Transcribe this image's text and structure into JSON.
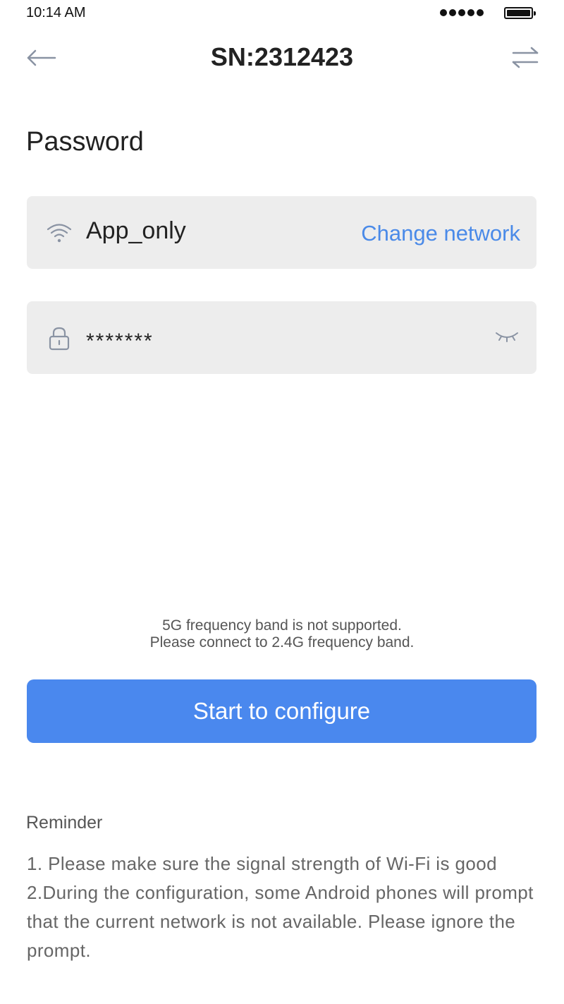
{
  "status_bar": {
    "time": "10:14 AM",
    "signal_icon": "signal-dots-icon",
    "battery_icon": "battery-icon"
  },
  "nav": {
    "title": "SN:2312423",
    "back_icon": "arrow-left-icon",
    "switch_icon": "swap-arrows-icon"
  },
  "section": {
    "title": "Password"
  },
  "network": {
    "icon": "wifi-icon",
    "name": "App_only",
    "change_label": "Change network"
  },
  "password": {
    "icon": "lock-icon",
    "value": "*******",
    "toggle_icon": "eye-closed-icon"
  },
  "notice": {
    "line1": "5G frequency band is not supported.",
    "line2": "Please connect to 2.4G frequency band."
  },
  "actions": {
    "start_label": "Start to configure"
  },
  "reminder": {
    "title": "Reminder",
    "line1": "1. Please make sure the signal strength of Wi-Fi is good",
    "line2": "2.During the configuration, some Android phones will prompt that the current network is not available. Please ignore the prompt."
  },
  "colors": {
    "accent": "#4a88ee",
    "link": "#4a8ae8",
    "field_bg": "#ededed",
    "icon_gray": "#8a93a3"
  }
}
